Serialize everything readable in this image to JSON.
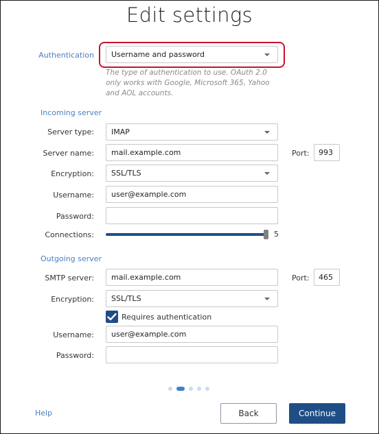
{
  "title": "Edit settings",
  "authentication": {
    "label": "Authentication",
    "value": "Username and password",
    "hint": "The type of authentication to use. OAuth 2.0 only works with Google, Microsoft 365, Yahoo and AOL accounts.",
    "highlight_color": "#c8102e"
  },
  "incoming": {
    "section_label": "Incoming server",
    "server_type_label": "Server type:",
    "server_type_value": "IMAP",
    "server_name_label": "Server name:",
    "server_name_value": "mail.example.com",
    "port_label": "Port:",
    "port_value": "993",
    "encryption_label": "Encryption:",
    "encryption_value": "SSL/TLS",
    "username_label": "Username:",
    "username_value": "user@example.com",
    "password_label": "Password:",
    "password_value": "",
    "connections_label": "Connections:",
    "connections_value": "5",
    "connections_fraction": 1.0
  },
  "outgoing": {
    "section_label": "Outgoing server",
    "smtp_label": "SMTP server:",
    "smtp_value": "mail.example.com",
    "port_label": "Port:",
    "port_value": "465",
    "encryption_label": "Encryption:",
    "encryption_value": "SSL/TLS",
    "requires_auth_label": "Requires authentication",
    "requires_auth_checked": true,
    "username_label": "Username:",
    "username_value": "user@example.com",
    "password_label": "Password:",
    "password_value": ""
  },
  "pagination": {
    "total": 5,
    "current": 2
  },
  "footer": {
    "help_label": "Help",
    "back_label": "Back",
    "continue_label": "Continue"
  },
  "colors": {
    "accent": "#1f4e87",
    "link": "#4a7fc1"
  }
}
